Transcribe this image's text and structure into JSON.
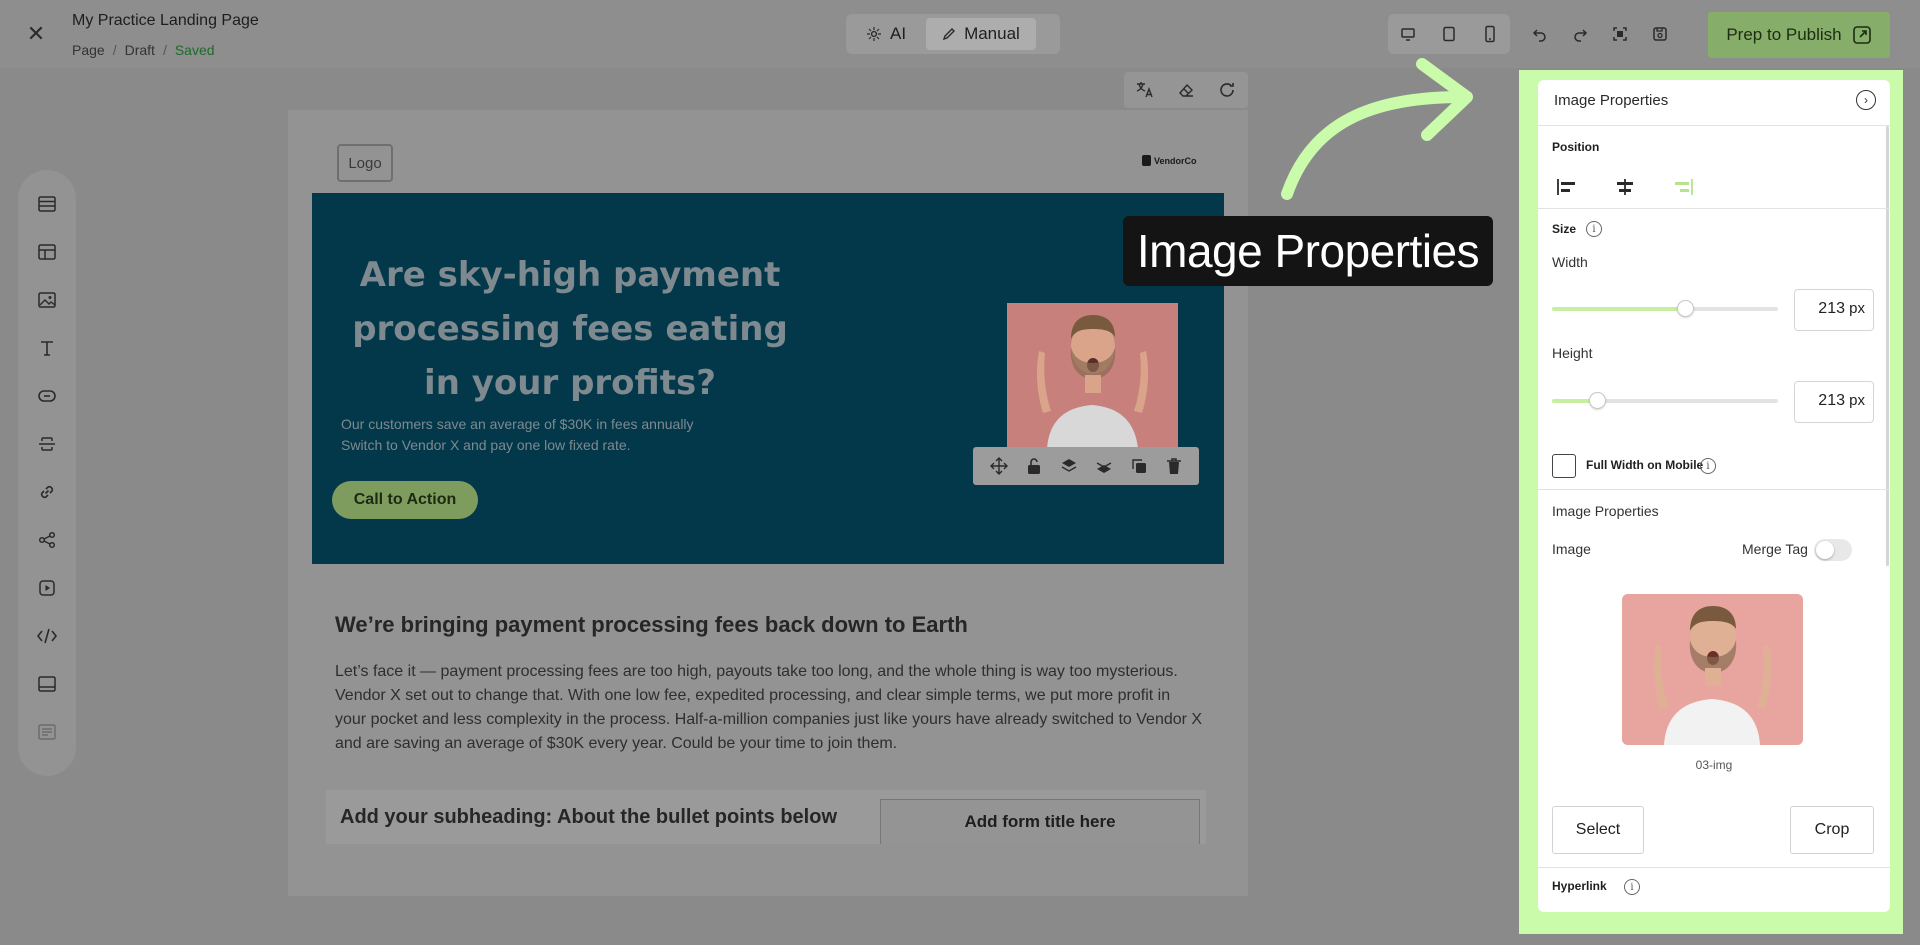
{
  "header": {
    "page_title": "My Practice Landing Page",
    "breadcrumb": [
      "Page",
      "Draft",
      "Saved"
    ],
    "modes": [
      {
        "label": "AI",
        "icon": "sparkle-icon"
      },
      {
        "label": "Manual",
        "icon": "pencil-icon"
      }
    ],
    "active_mode": "Manual",
    "publish_label": "Prep to Publish",
    "accent_color": "#86ad6a"
  },
  "palette": {
    "tools": [
      "rows-icon",
      "layout-icon",
      "image-icon",
      "text-icon",
      "button-icon",
      "divider-icon",
      "link-icon",
      "social-share-icon",
      "video-icon",
      "code-icon",
      "footer-icon",
      "form-icon"
    ]
  },
  "canvas": {
    "logo_placeholder": "Logo",
    "vendor_logo": "VendorCo",
    "hero": {
      "title": "Are sky-high payment processing fees eating in your profits?",
      "subtitle_lines": [
        "Our customers save an average of $30K in fees annually",
        "Switch to Vendor X and pay one low fixed rate."
      ],
      "cta": "Call to Action",
      "background": "#03374a"
    },
    "section": {
      "heading": "We’re bringing payment processing fees back down to Earth",
      "body": "Let’s face it — payment processing fees are too high, payouts take too long, and the whole thing is way too mysterious. Vendor X set out to change that. With one low fee, expedited processing, and clear simple terms, we put more profit in your pocket and less complexity in the process. Half-a-million companies just like yours have already switched to Vendor X and are saving an average of $30K every year. Could be your time to join them."
    },
    "subheading": "Add your subheading: About the bullet points below",
    "form_title": "Add form title here"
  },
  "callout": {
    "text": "Image Properties",
    "arrow_color": "#c9fbab"
  },
  "panel": {
    "title": "Image Properties",
    "position_label": "Position",
    "position_active": "right",
    "size_label": "Size",
    "width_label": "Width",
    "width_value": "213",
    "width_slider_fraction": 0.59,
    "height_label": "Height",
    "height_value": "213",
    "height_slider_fraction": 0.2,
    "unit": "px",
    "full_width_mobile_label": "Full Width on Mobile",
    "image_props_label": "Image Properties",
    "image_label": "Image",
    "merge_tag_label": "Merge Tag",
    "image_caption": "03-img",
    "select_label": "Select",
    "crop_label": "Crop",
    "hyperlink_label": "Hyperlink",
    "frame_color": "#c9fbab"
  }
}
